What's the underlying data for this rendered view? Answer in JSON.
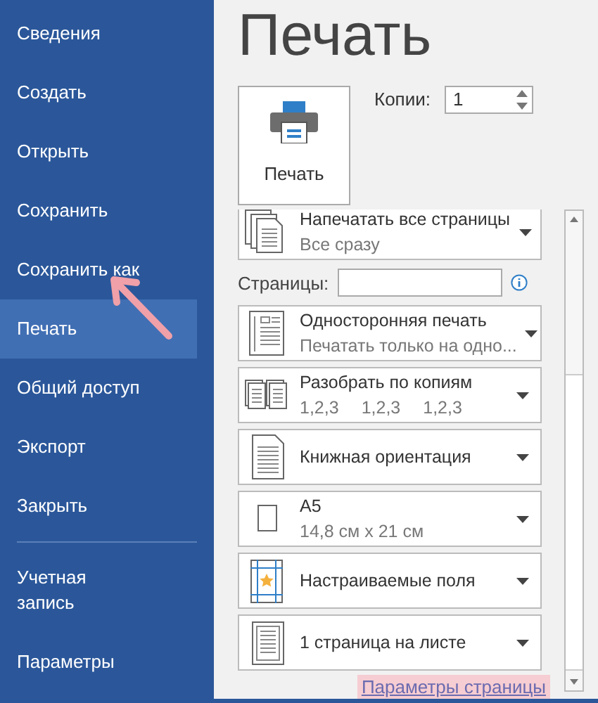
{
  "sidebar": {
    "groups": [
      [
        {
          "label": "Сведения",
          "selected": false
        },
        {
          "label": "Создать",
          "selected": false
        },
        {
          "label": "Открыть",
          "selected": false
        },
        {
          "label": "Сохранить",
          "selected": false
        },
        {
          "label": "Сохранить как",
          "selected": false
        },
        {
          "label": "Печать",
          "selected": true
        },
        {
          "label": "Общий доступ",
          "selected": false
        },
        {
          "label": "Экспорт",
          "selected": false
        },
        {
          "label": "Закрыть",
          "selected": false
        }
      ],
      [
        {
          "label": "Учетная запись",
          "selected": false
        },
        {
          "label": "Параметры",
          "selected": false
        }
      ]
    ]
  },
  "title": "Печать",
  "print_button": {
    "label": "Печать"
  },
  "copies": {
    "label": "Копии:",
    "value": "1"
  },
  "settings": [
    {
      "kind": "pages",
      "title": "Напечатать все страницы",
      "subtitle": [
        "Все сразу"
      ]
    },
    {
      "kind": "field",
      "label": "Страницы:"
    },
    {
      "kind": "sides",
      "title": "Односторонняя печать",
      "subtitle": [
        "Печатать только на одно..."
      ]
    },
    {
      "kind": "collate",
      "title": "Разобрать по копиям",
      "subtitle": [
        "1,2,3",
        "1,2,3",
        "1,2,3"
      ]
    },
    {
      "kind": "orientation",
      "title": "Книжная ориентация"
    },
    {
      "kind": "paper",
      "title": "A5",
      "subtitle": [
        "14,8 см x 21 см"
      ]
    },
    {
      "kind": "margins",
      "title": "Настраиваемые поля"
    },
    {
      "kind": "per_sheet",
      "title": "1 страница на листе"
    }
  ],
  "page_setup_link": "Параметры страницы"
}
